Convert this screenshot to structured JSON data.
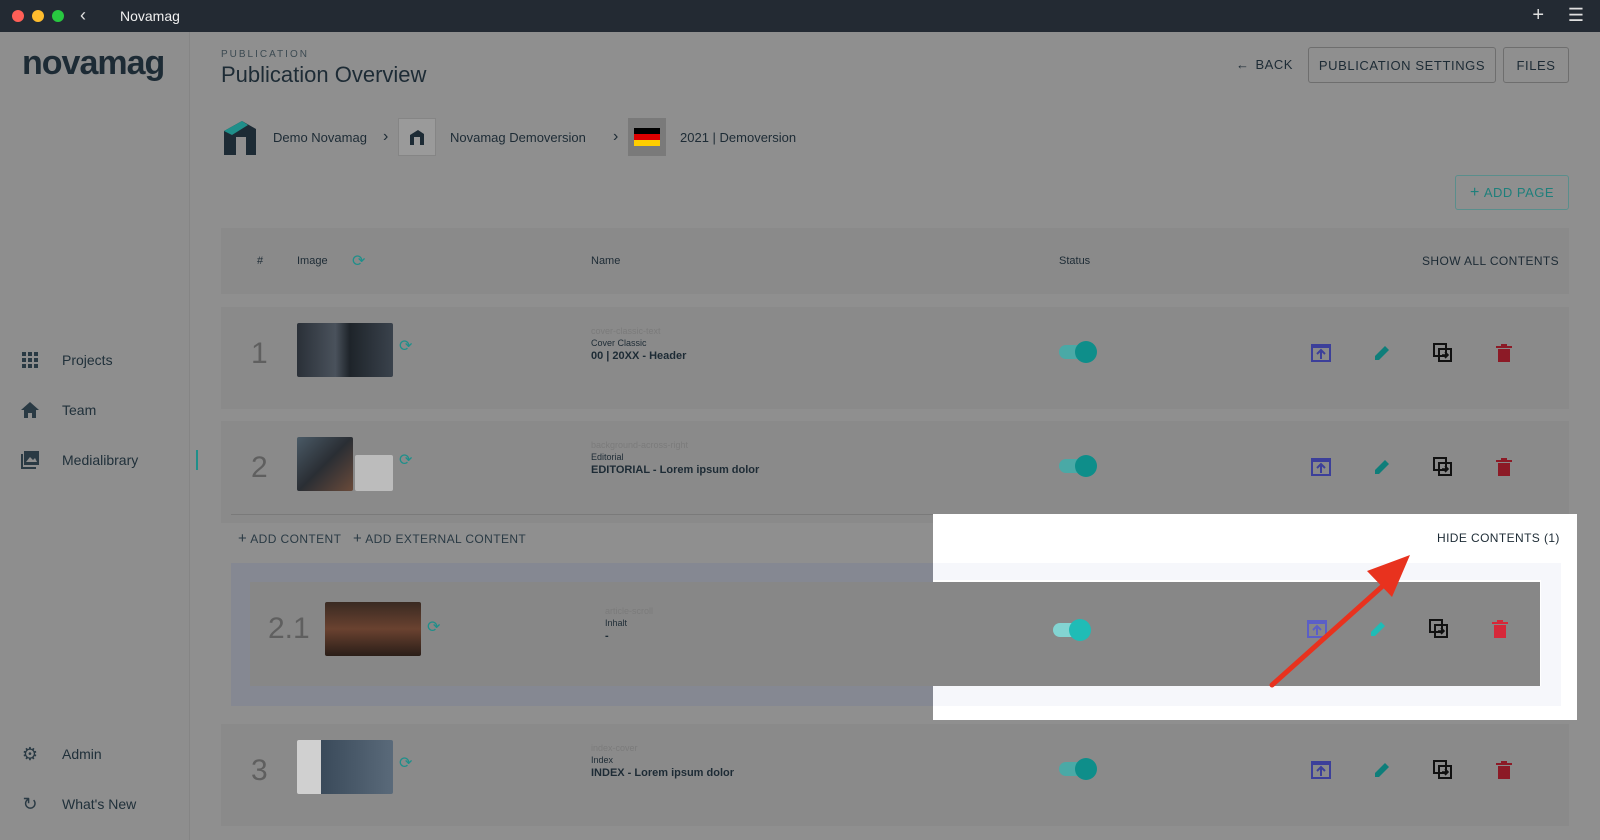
{
  "window": {
    "title": "Novamag"
  },
  "sidebar": {
    "logo": "novamag",
    "items": [
      {
        "label": "Projects",
        "icon": "grid-icon"
      },
      {
        "label": "Team",
        "icon": "home-icon"
      },
      {
        "label": "Medialibrary",
        "icon": "image-icon"
      },
      {
        "label": "Admin",
        "icon": "gear-icon"
      },
      {
        "label": "What's New",
        "icon": "history-icon"
      }
    ]
  },
  "header": {
    "eyebrow": "PUBLICATION",
    "title": "Publication Overview",
    "back_label": "BACK",
    "settings_label": "PUBLICATION SETTINGS",
    "files_label": "FILES"
  },
  "breadcrumb": [
    {
      "label": "Demo Novamag"
    },
    {
      "label": "Novamag Demoversion"
    },
    {
      "label": "2021 | Demoversion"
    }
  ],
  "add_page_label": "ADD PAGE",
  "table": {
    "col_num": "#",
    "col_image": "Image",
    "col_name": "Name",
    "col_status": "Status",
    "show_all_label": "SHOW ALL CONTENTS"
  },
  "rows": [
    {
      "num": "1",
      "template": "cover-classic-text",
      "type": "Cover Classic",
      "name": "00 | 20XX - Header",
      "active": true
    },
    {
      "num": "2",
      "template": "background-across-right",
      "type": "Editorial",
      "name": "EDITORIAL - Lorem ipsum dolor",
      "active": true
    },
    {
      "num": "2.1",
      "template": "article-scroll",
      "type": "Inhalt",
      "name": "-",
      "active": true
    },
    {
      "num": "3",
      "template": "index-cover",
      "type": "Index",
      "name": "INDEX - Lorem ipsum dolor",
      "active": true
    }
  ],
  "content_actions": {
    "add_content_label": "ADD CONTENT",
    "add_external_label": "ADD EXTERNAL CONTENT",
    "hide_contents_label": "HIDE CONTENTS (1)"
  },
  "colors": {
    "accent": "#1f8f8a",
    "publish": "#5b5fc7",
    "delete": "#d62839",
    "annotation": "#e8321e"
  }
}
